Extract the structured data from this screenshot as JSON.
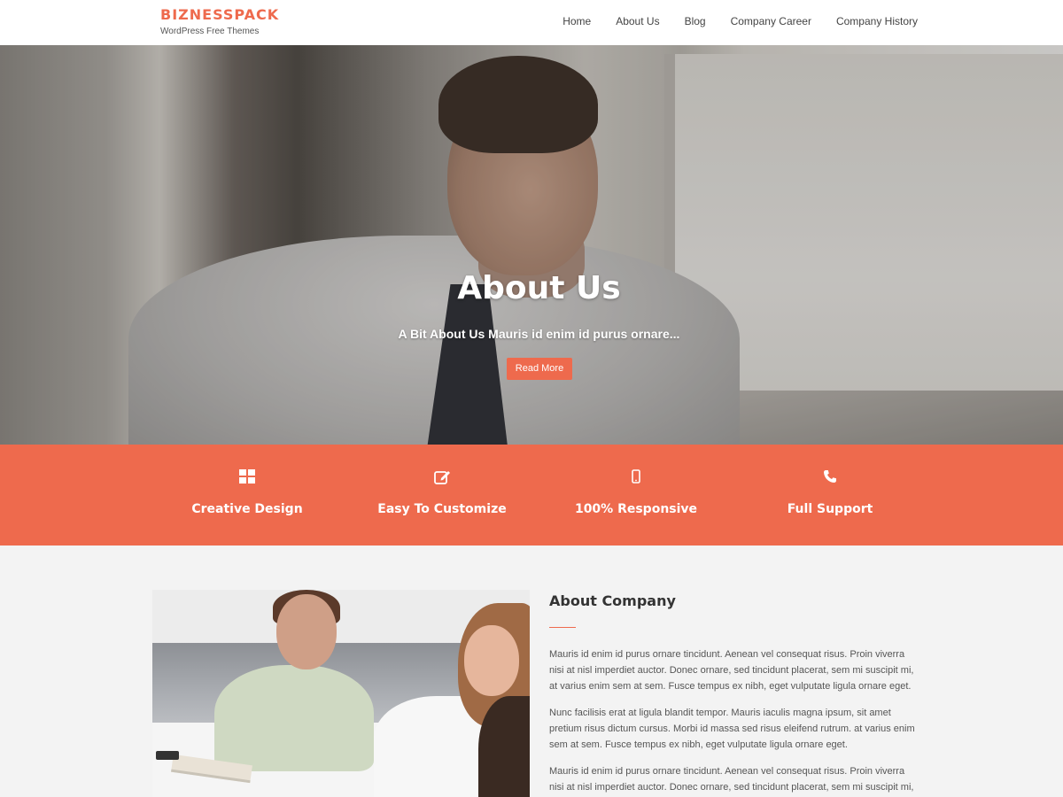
{
  "brand": {
    "name": "BIZNESSPACK",
    "tagline": "WordPress Free Themes",
    "accent": "#ee6a4d"
  },
  "nav": {
    "items": [
      {
        "label": "Home"
      },
      {
        "label": "About Us"
      },
      {
        "label": "Blog"
      },
      {
        "label": "Company Career"
      },
      {
        "label": "Company History"
      }
    ]
  },
  "hero": {
    "title": "About Us",
    "subtitle": "A Bit About Us Mauris id enim id purus ornare...",
    "button_label": "Read More"
  },
  "features": [
    {
      "icon": "grid-icon",
      "label": "Creative Design"
    },
    {
      "icon": "edit-icon",
      "label": "Easy To Customize"
    },
    {
      "icon": "mobile-icon",
      "label": "100% Responsive"
    },
    {
      "icon": "phone-icon",
      "label": "Full Support"
    }
  ],
  "about": {
    "title": "About Company",
    "paragraphs": [
      "Mauris id enim id purus ornare tincidunt. Aenean vel consequat risus. Proin viverra nisi at nisl imperdiet auctor. Donec ornare, sed tincidunt placerat, sem mi suscipit mi, at varius enim sem at sem. Fusce tempus ex nibh, eget vulputate ligula ornare eget.",
      "Nunc facilisis erat at ligula blandit tempor. Mauris iaculis magna ipsum, sit amet pretium risus dictum cursus. Morbi id massa sed risus eleifend rutrum. at varius enim sem at sem. Fusce tempus ex nibh, eget vulputate ligula ornare eget.",
      "Mauris id enim id purus ornare tincidunt. Aenean vel consequat risus. Proin viverra nisi at nisl imperdiet auctor. Donec ornare, sed tincidunt placerat, sem mi suscipit mi,"
    ]
  }
}
